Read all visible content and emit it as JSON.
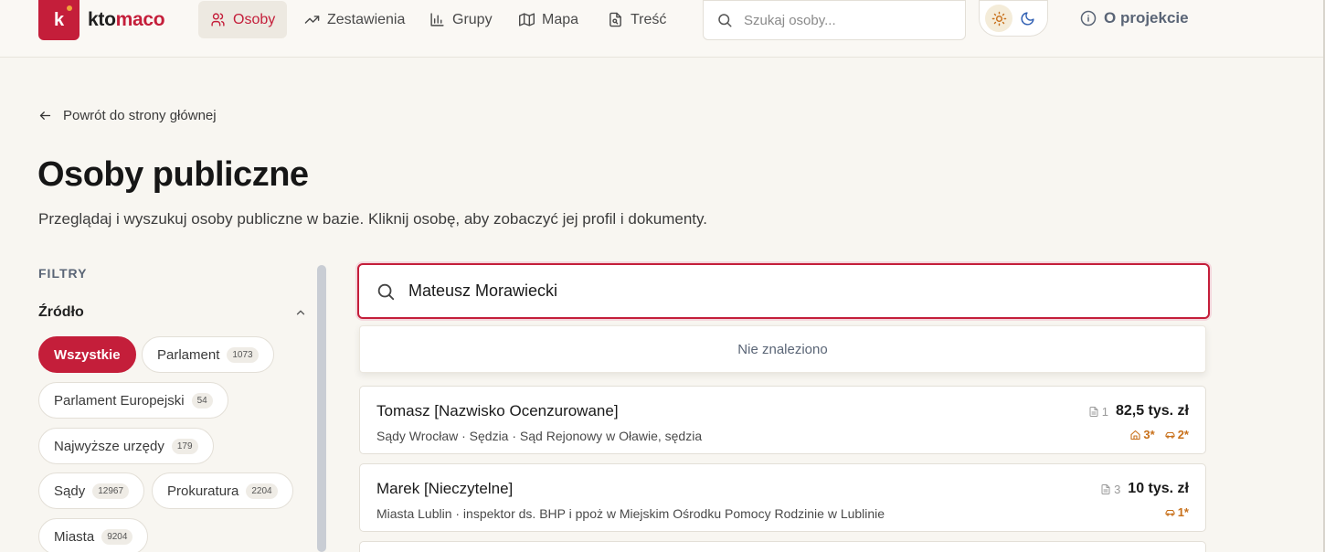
{
  "header": {
    "logo_letter": "k",
    "logo_text_a": "kto",
    "logo_text_b": "maco",
    "nav": [
      {
        "label": "Osoby",
        "icon": "users-icon",
        "active": true
      },
      {
        "label": "Zestawienia",
        "icon": "trending-icon"
      },
      {
        "label": "Grupy",
        "icon": "bar-chart-icon"
      },
      {
        "label": "Mapa",
        "icon": "map-icon"
      },
      {
        "label": "Treść",
        "icon": "document-icon"
      }
    ],
    "search_placeholder": "Szukaj osoby...",
    "about_label": "O projekcie"
  },
  "page": {
    "back_label": "Powrót do strony głównej",
    "title": "Osoby publiczne",
    "description": "Przeglądaj i wyszukuj osoby publiczne w bazie. Kliknij osobę, aby zobaczyć jej profil i dokumenty."
  },
  "filters": {
    "heading": "FILTRY",
    "source_label": "Źródło",
    "chips": [
      {
        "label": "Wszystkie",
        "count": "",
        "active": true
      },
      {
        "label": "Parlament",
        "count": "1073"
      },
      {
        "label": "Parlament Europejski",
        "count": "54"
      },
      {
        "label": "Najwyższe urzędy",
        "count": "179"
      },
      {
        "label": "Sądy",
        "count": "12967"
      },
      {
        "label": "Prokuratura",
        "count": "2204"
      },
      {
        "label": "Miasta",
        "count": "9204"
      }
    ]
  },
  "search": {
    "value": "Mateusz Morawiecki",
    "not_found": "Nie znaleziono"
  },
  "results": [
    {
      "name": "Tomasz [Nazwisko Ocenzurowane]",
      "meta": "Sądy Wrocław · Sędzia · Sąd Rejonowy w Oławie, sędzia",
      "docs": "1",
      "amount": "82,5 tys. zł",
      "houses": "3*",
      "cars": "2*"
    },
    {
      "name": "Marek [Nieczytelne]",
      "meta": "Miasta Lublin · inspektor ds. BHP i ppoż w Miejskim Ośrodku Pomocy Rodzinie w Lublinie",
      "docs": "3",
      "amount": "10 tys. zł",
      "cars": "1*"
    }
  ],
  "colors": {
    "accent": "#c41e3a",
    "asset": "#c8701a",
    "background": "#f8f6f1"
  }
}
